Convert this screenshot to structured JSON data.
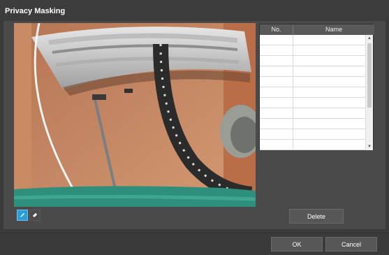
{
  "dialog": {
    "title": "Privacy Masking"
  },
  "mask_tools": [
    {
      "name": "draw-mask",
      "icon": "pencil-icon",
      "active": true
    },
    {
      "name": "erase-mask",
      "icon": "eraser-icon",
      "active": false
    }
  ],
  "mask_list": {
    "headers": {
      "no": "No.",
      "name": "Name"
    },
    "rows": [
      {
        "no": "",
        "name": ""
      },
      {
        "no": "",
        "name": ""
      },
      {
        "no": "",
        "name": ""
      },
      {
        "no": "",
        "name": ""
      },
      {
        "no": "",
        "name": ""
      },
      {
        "no": "",
        "name": ""
      },
      {
        "no": "",
        "name": ""
      },
      {
        "no": "",
        "name": ""
      },
      {
        "no": "",
        "name": ""
      },
      {
        "no": "",
        "name": ""
      },
      {
        "no": "",
        "name": ""
      }
    ]
  },
  "buttons": {
    "delete": "Delete",
    "ok": "OK",
    "cancel": "Cancel"
  },
  "colors": {
    "accent": "#2a9fd6",
    "background": "#3a3a3a",
    "panel": "#4a4a4a"
  }
}
